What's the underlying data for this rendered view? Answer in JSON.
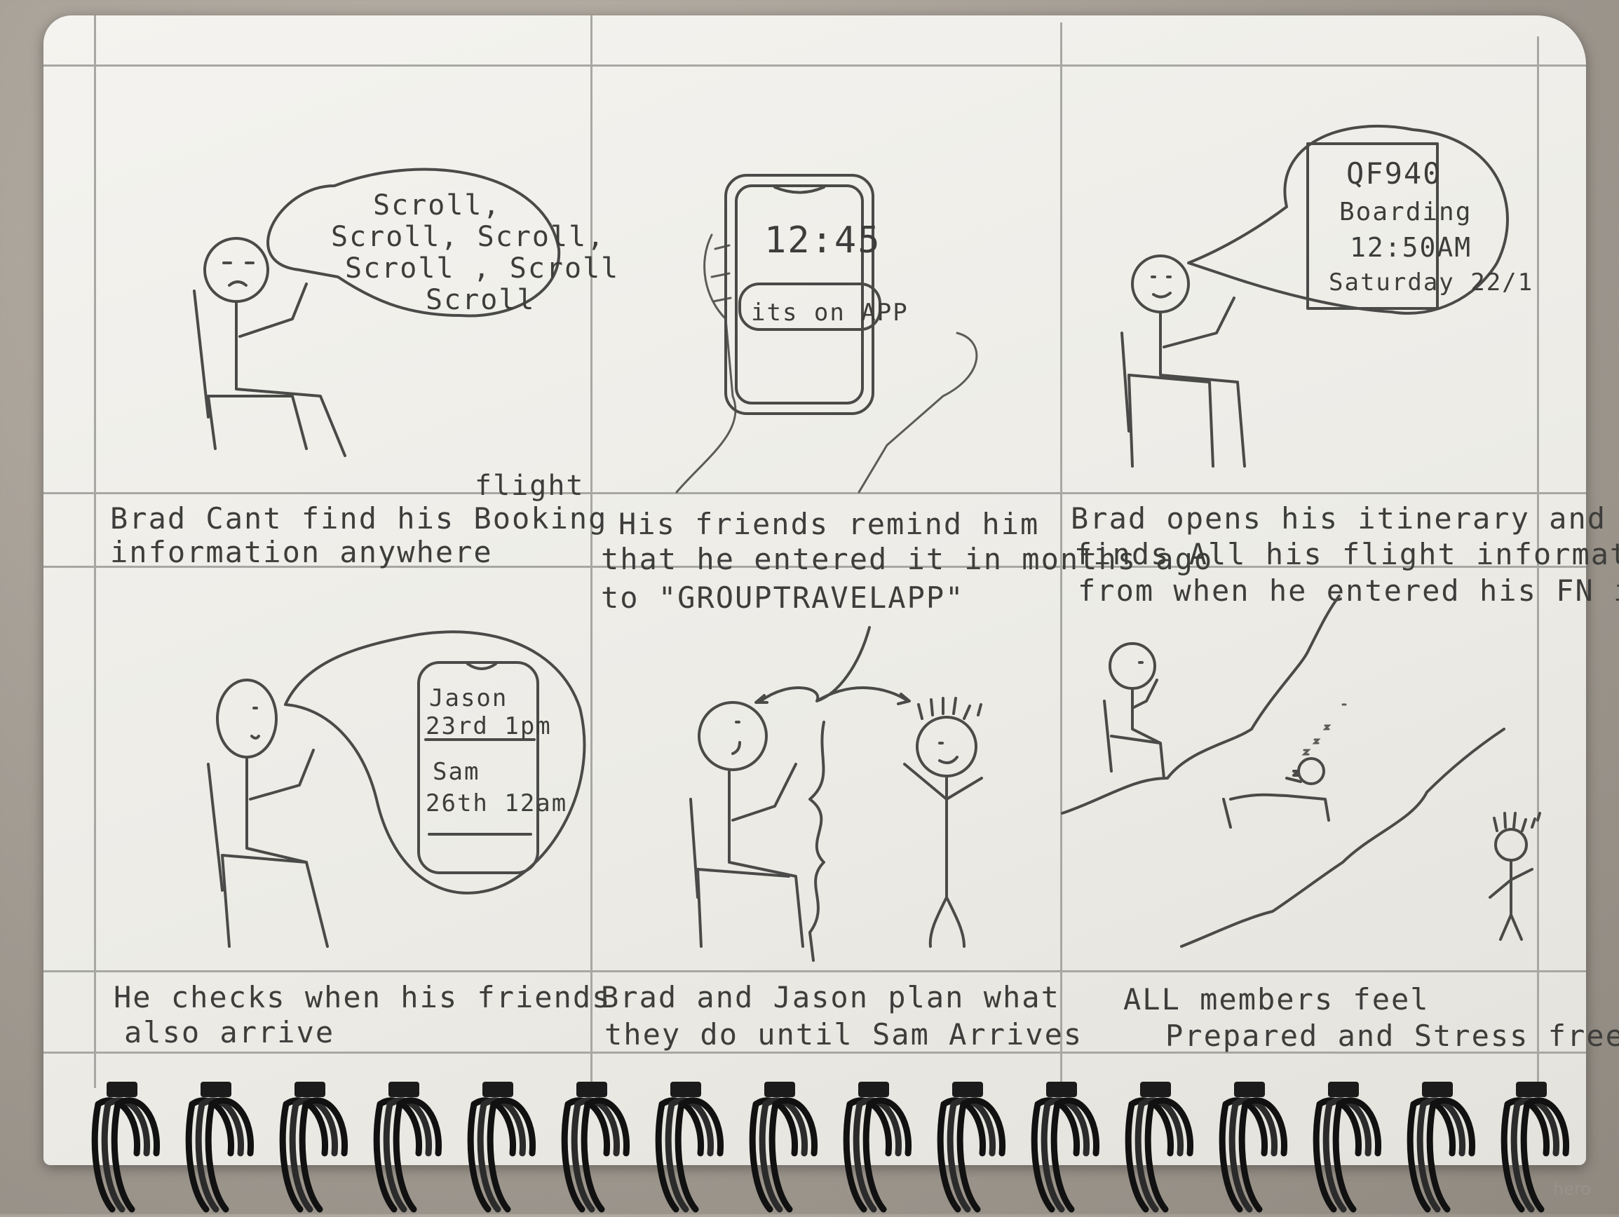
{
  "panels": [
    {
      "bubble": [
        "Scroll,",
        "Scroll, Scroll,",
        "Scroll , Scroll",
        "Scroll"
      ],
      "insert": "flight",
      "caption": [
        "Brad Cant find his Booking",
        "information anywhere"
      ]
    },
    {
      "phone_time": "12:45",
      "phone_notice": "its on APP",
      "caption": [
        "His friends remind him",
        "that he entered it in months ago",
        "to \"GROUPTRAVELAPP\""
      ]
    },
    {
      "bubble": [
        "QF940",
        "Boarding",
        "12:50AM",
        "Saturday 22/1"
      ],
      "caption": [
        "Brad opens his itinerary and",
        "finds All his flight information",
        "from when he entered his FN in"
      ]
    },
    {
      "phone_lines": [
        "Jason",
        "23rd 1pm",
        "Sam",
        "26th 12am"
      ],
      "caption": [
        "He checks when his friends",
        "also arrive"
      ]
    },
    {
      "caption": [
        "Brad and Jason plan what",
        "they do until Sam Arrives"
      ]
    },
    {
      "caption": [
        "ALL members feel",
        "Prepared and Stress free"
      ]
    }
  ],
  "watermark": "hero"
}
